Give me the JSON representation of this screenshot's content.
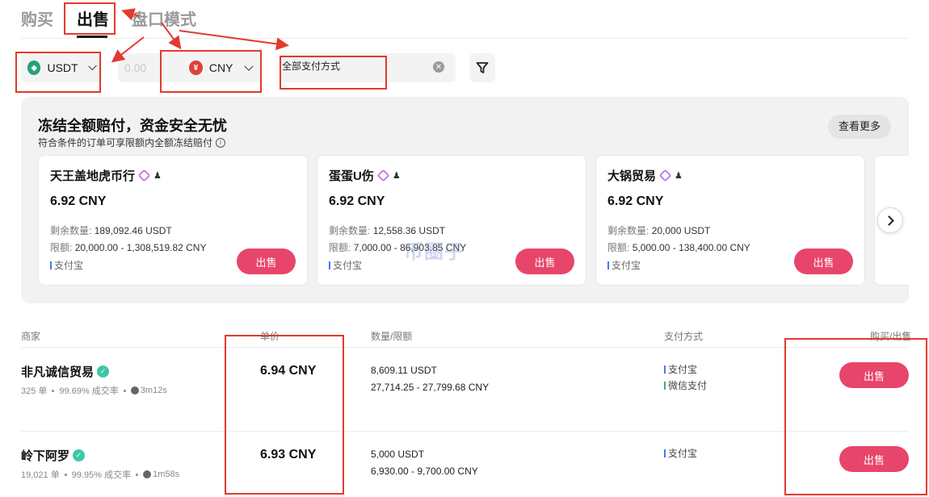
{
  "tabs": {
    "buy": "购买",
    "sell": "出售",
    "orderbook": "盘口模式"
  },
  "filters": {
    "coin": "USDT",
    "amount_placeholder": "0.00",
    "fiat_symbol": "¥",
    "fiat": "CNY",
    "payment": "全部支付方式"
  },
  "promo": {
    "title": "冻结全额赔付，资金安全无忧",
    "subtitle": "符合条件的订单可享限额内全额冻结赔付",
    "see_more": "查看更多",
    "cards": [
      {
        "name": "天王盖地虎币行",
        "price": "6.92 CNY",
        "remain_label": "剩余数量:",
        "remain": "189,092.46 USDT",
        "limit_label": "限额:",
        "limit": "20,000.00 - 1,308,519.82 CNY",
        "pay": "支付宝",
        "btn": "出售"
      },
      {
        "name": "蛋蛋U伤",
        "price": "6.92 CNY",
        "remain_label": "剩余数量:",
        "remain": "12,558.36 USDT",
        "limit_label": "限额:",
        "limit": "7,000.00 - 86,903.85 CNY",
        "pay": "支付宝",
        "btn": "出售"
      },
      {
        "name": "大锅贸易",
        "price": "6.92 CNY",
        "remain_label": "剩余数量:",
        "remain": "20,000 USDT",
        "limit_label": "限额:",
        "limit": "5,000.00 - 138,400.00 CNY",
        "pay": "支付宝",
        "btn": "出售"
      }
    ]
  },
  "table": {
    "headers": {
      "merchant": "商家",
      "price": "单价",
      "qty": "数量/限额",
      "pay": "支付方式",
      "action": "购买/出售"
    },
    "rows": [
      {
        "name": "非凡诚信贸易",
        "orders": "325 单",
        "rate": "99.69% 成交率",
        "time": "3m12s",
        "price": "6.94 CNY",
        "qty": "8,609.11 USDT",
        "limit": "27,714.25 - 27,799.68 CNY",
        "pays": [
          "支付宝",
          "微信支付"
        ],
        "btn": "出售"
      },
      {
        "name": "岭下阿罗",
        "orders": "19,021 单",
        "rate": "99.95% 成交率",
        "time": "1m58s",
        "price": "6.93 CNY",
        "qty": "5,000 USDT",
        "limit": "6,930.00 - 9,700.00 CNY",
        "pays": [
          "支付宝"
        ],
        "btn": "出售"
      }
    ]
  },
  "watermark": "币圈子",
  "colors": {
    "accent": "#e8456b",
    "annotation": "#e23a2e",
    "tether": "#26a17b",
    "cny": "#e0413a",
    "alipay_bar": "#3a7bff",
    "wechat_bar": "#2eb872"
  }
}
